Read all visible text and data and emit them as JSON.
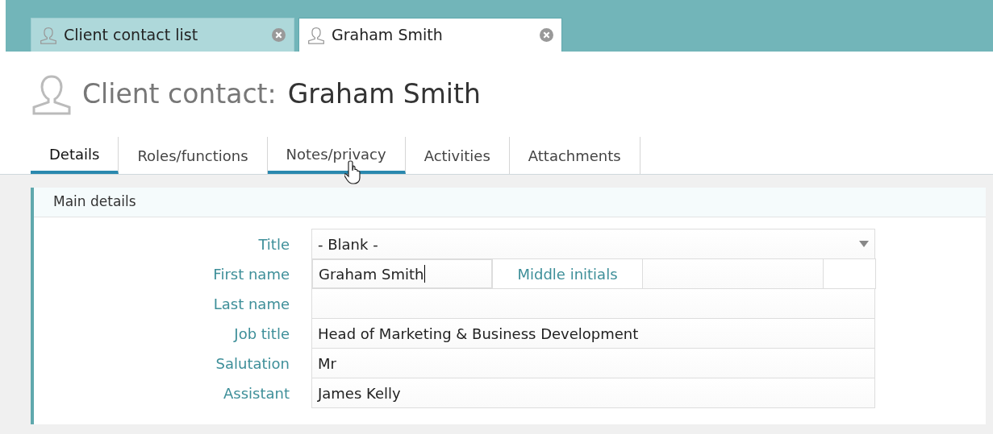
{
  "doc_tabs": [
    {
      "label": "Client contact list",
      "selected": false
    },
    {
      "label": "Graham Smith",
      "selected": true
    }
  ],
  "header": {
    "prefix": "Client contact:",
    "name": "Graham Smith"
  },
  "tabs": [
    {
      "label": "Details",
      "selected": true,
      "hovered": false
    },
    {
      "label": "Roles/functions",
      "selected": false,
      "hovered": false
    },
    {
      "label": "Notes/privacy",
      "selected": false,
      "hovered": true
    },
    {
      "label": "Activities",
      "selected": false,
      "hovered": false
    },
    {
      "label": "Attachments",
      "selected": false,
      "hovered": false
    }
  ],
  "section": {
    "title": "Main details",
    "fields": [
      {
        "kind": "select",
        "label": "Title",
        "value": "- Blank -"
      },
      {
        "kind": "name",
        "label": "First name",
        "value": "Graham Smith",
        "focused": true,
        "extra_label": "Middle initials"
      },
      {
        "kind": "text",
        "label": "Last name"
      },
      {
        "kind": "text",
        "label": "Job title",
        "value": "Head of Marketing & Business Development"
      },
      {
        "kind": "text",
        "label": "Salutation",
        "value": "Mr"
      },
      {
        "kind": "text",
        "label": "Assistant",
        "value": "James Kelly"
      }
    ]
  }
}
